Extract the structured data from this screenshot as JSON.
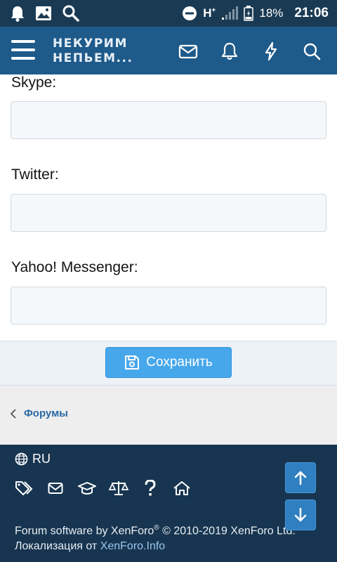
{
  "status_bar": {
    "icons_left": [
      "notification-bell-icon",
      "image-icon",
      "search-icon"
    ],
    "network": "H",
    "network_sup": "+",
    "battery_percent": "18%",
    "time": "21:06"
  },
  "header": {
    "logo_line1": "НЕКУРИМ",
    "logo_line2": "НЕПЬЕМ...",
    "icons": [
      "mail-icon",
      "bell-icon",
      "lightning-icon",
      "search-icon"
    ],
    "bg_color": "#1e5a8a"
  },
  "form": {
    "fields": [
      {
        "label": "Skype:",
        "value": ""
      },
      {
        "label": "Twitter:",
        "value": ""
      },
      {
        "label": "Yahoo! Messenger:",
        "value": ""
      }
    ],
    "save_label": "Сохранить"
  },
  "breadcrumb": {
    "label": "Форумы"
  },
  "footer": {
    "language": "RU",
    "icons": [
      "tags-icon",
      "mail-icon",
      "graduation-cap-icon",
      "scales-icon",
      "help-icon",
      "home-icon"
    ],
    "credit_prefix": "Forum software by XenForo",
    "credit_reg": "®",
    "credit_suffix": " © 2010-2019 XenForo Ltd.",
    "localization_prefix": "Локализация от ",
    "localization_link": "XenForo.Info"
  }
}
